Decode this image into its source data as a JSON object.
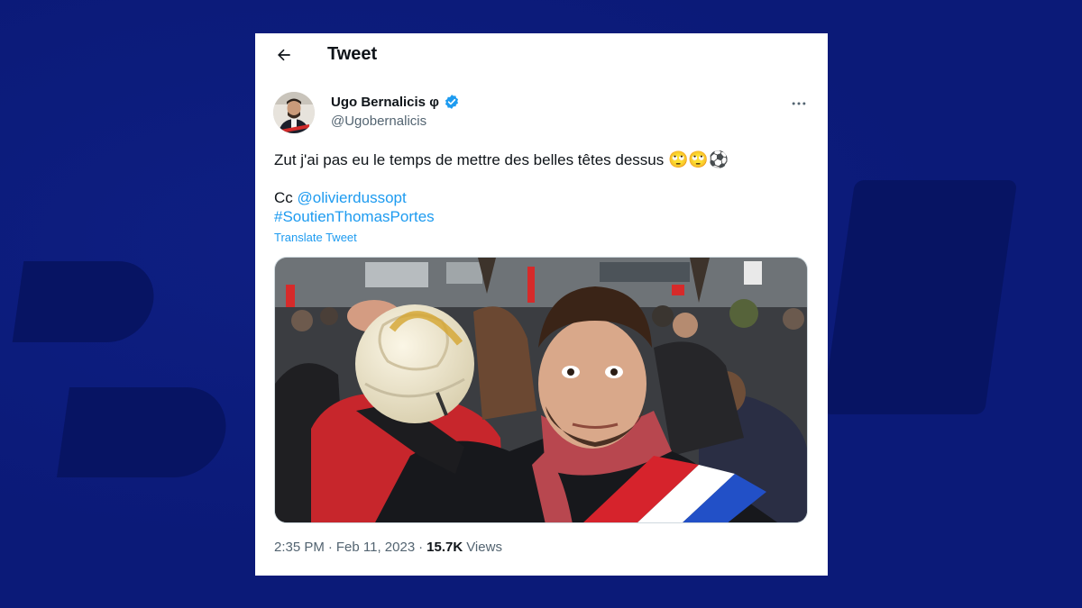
{
  "header": {
    "title": "Tweet"
  },
  "author": {
    "name": "Ugo Bernalicis φ",
    "handle": "@Ugobernalicis"
  },
  "tweet": {
    "text": "Zut j'ai pas eu le temps de mettre des belles têtes dessus",
    "emojis": [
      "🙄",
      "🙄",
      "⚽"
    ],
    "cc_prefix": "Cc ",
    "mention": "@olivierdussopt",
    "hashtag": "#SoutienThomasPortes",
    "translate_label": "Translate Tweet"
  },
  "meta": {
    "time": "2:35 PM",
    "separator1": "·",
    "date": "Feb 11, 2023",
    "separator2": "·",
    "views_count": "15.7K",
    "views_label": "Views"
  },
  "icons": {
    "back": "arrow-left-icon",
    "verified": "verified-badge-icon",
    "more": "more-horizontal-icon"
  },
  "colors": {
    "background": "#0b1a78",
    "link": "#1d9bf0",
    "text": "#0f1419",
    "secondary": "#536471",
    "verified": "#1d9bf0"
  }
}
